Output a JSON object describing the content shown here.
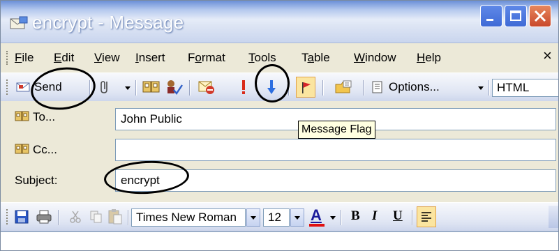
{
  "window": {
    "title": "encrypt - Message",
    "icon": "envelope-icon",
    "controls": [
      "minimize-icon",
      "maximize-icon",
      "close-icon"
    ]
  },
  "menu": {
    "items": [
      {
        "label": "File",
        "accel": "F"
      },
      {
        "label": "Edit",
        "accel": "E"
      },
      {
        "label": "View",
        "accel": "V"
      },
      {
        "label": "Insert",
        "accel": "I"
      },
      {
        "label": "Format",
        "accel": "o"
      },
      {
        "label": "Tools",
        "accel": "T"
      },
      {
        "label": "Table",
        "accel": "a"
      },
      {
        "label": "Window",
        "accel": "W"
      },
      {
        "label": "Help",
        "accel": "H"
      }
    ],
    "close_glyph": "×"
  },
  "toolbar": {
    "send_label": "Send",
    "options_label": "Options...",
    "format_value": "HTML",
    "icons": [
      "attach-icon",
      "address-book-icon",
      "check-names-icon",
      "permission-icon",
      "high-importance-icon",
      "low-importance-icon",
      "message-flag-icon",
      "options-folder-icon"
    ]
  },
  "fields": {
    "to_label": "To...",
    "to_value": "John Public",
    "cc_label": "Cc...",
    "cc_value": "",
    "subject_label": "Subject:",
    "subject_value": "encrypt"
  },
  "tooltip": "Message Flag",
  "format_toolbar": {
    "font": "Times New Roman",
    "size": "12",
    "font_color_glyph": "A",
    "bold": "B",
    "italic": "I",
    "underline": "U"
  },
  "colors": {
    "titlebar_text": "#ffffff",
    "window_bg": "#ece9d8",
    "close_button": "#c8482b",
    "accent_blue": "#3f6bd6"
  }
}
